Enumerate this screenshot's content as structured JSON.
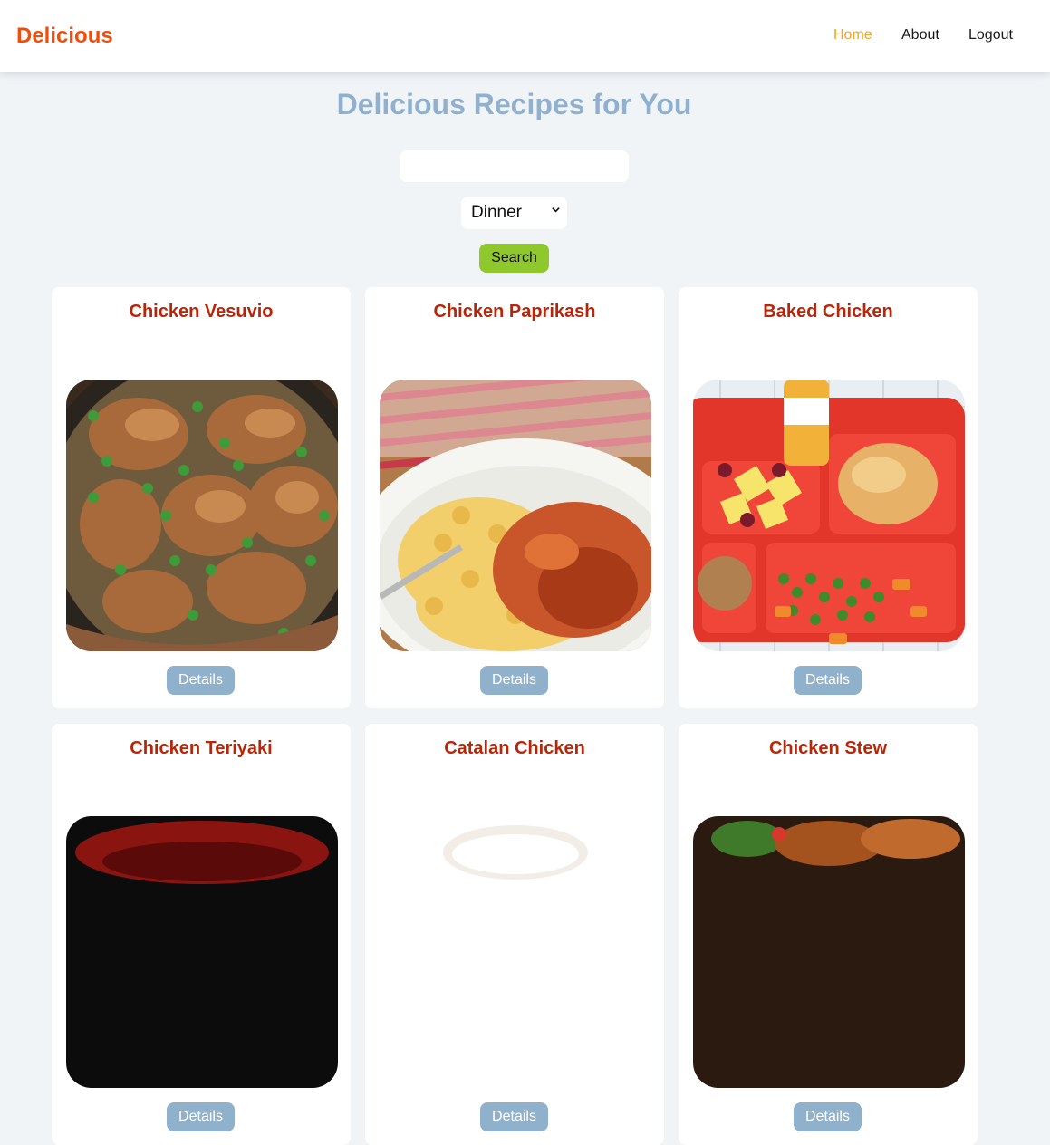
{
  "nav": {
    "brand": "Delicious",
    "links": [
      {
        "label": "Home",
        "active": true
      },
      {
        "label": "About",
        "active": false
      },
      {
        "label": "Logout",
        "active": false
      }
    ]
  },
  "main": {
    "title": "Delicious Recipes for You",
    "search": {
      "value": "",
      "placeholder": ""
    },
    "category": {
      "selected": "Dinner"
    },
    "search_button": "Search"
  },
  "recipes": [
    {
      "title": "Chicken Vesuvio",
      "details_label": "Details"
    },
    {
      "title": "Chicken Paprikash",
      "details_label": "Details"
    },
    {
      "title": "Baked Chicken",
      "details_label": "Details"
    },
    {
      "title": "Chicken Teriyaki",
      "details_label": "Details"
    },
    {
      "title": "Catalan Chicken",
      "details_label": "Details"
    },
    {
      "title": "Chicken Stew",
      "details_label": "Details"
    }
  ],
  "colors": {
    "brand": "#f04e0c",
    "nav_active": "#f2a31c",
    "title": "#8fb1cf",
    "card_title": "#b8260a",
    "search_button": "#8fc82c",
    "details_button": "#8fb1cc",
    "background": "#f0f4f7"
  }
}
